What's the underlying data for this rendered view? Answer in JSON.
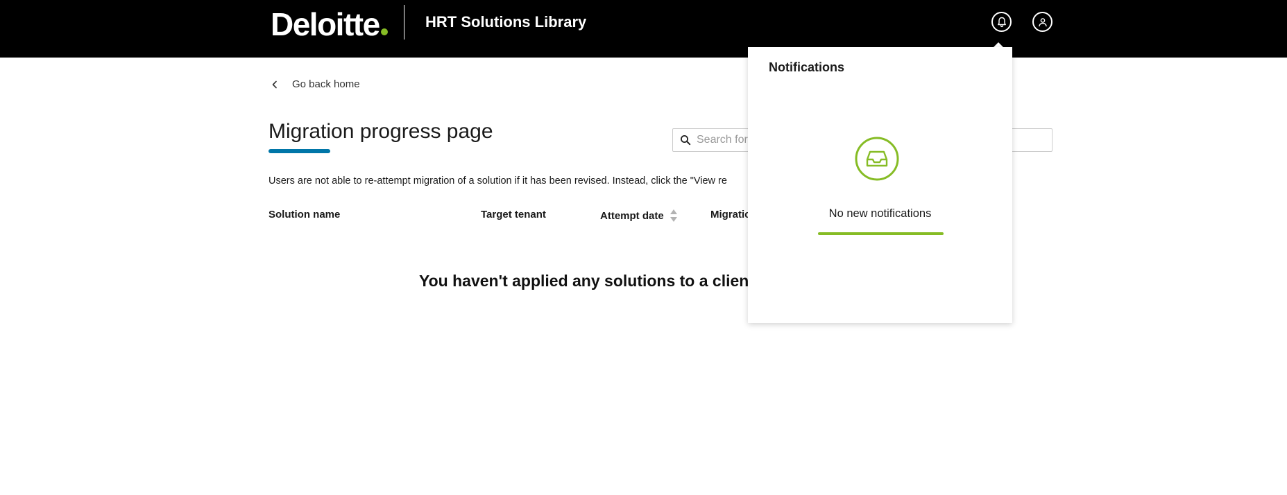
{
  "header": {
    "brand": "Deloitte",
    "app_title": "HRT Solutions Library",
    "notifications_icon": "bell-icon",
    "profile_icon": "user-icon",
    "brand_dot_color": "#86bc25",
    "background_color": "#000000"
  },
  "nav": {
    "back_label": "Go back home",
    "back_icon": "chevron-left-icon"
  },
  "page": {
    "title": "Migration progress page",
    "title_accent_color": "#0076a8",
    "search_placeholder": "Search for",
    "info_text": "Users are not able to re-attempt migration of a solution if it has been revised. Instead, click the \"View re"
  },
  "table": {
    "columns": [
      "Solution name",
      "Target tenant",
      "Attempt date",
      "Migratic"
    ],
    "sort_icon": "sort-icon",
    "empty_message": "You haven't applied any solutions to a clien"
  },
  "notifications": {
    "title": "Notifications",
    "empty_icon": "inbox-icon",
    "empty_text": "No new notifications",
    "accent_color": "#86bc25"
  }
}
